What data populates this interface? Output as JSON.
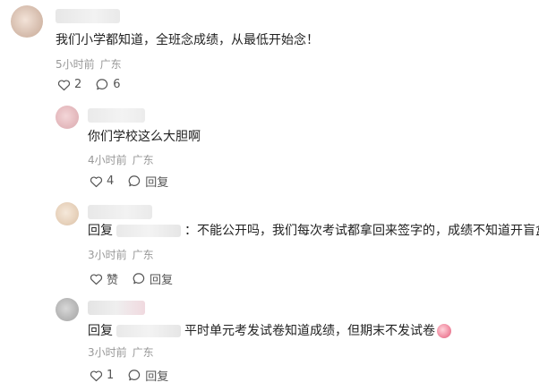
{
  "comments": [
    {
      "text": "我们小学都知道，全班念成绩，从最低开始念！",
      "time": "5小时前",
      "location": "广东",
      "likes": "2",
      "replies": "6"
    }
  ],
  "replies": [
    {
      "text": "你们学校这么大胆啊",
      "time": "4小时前",
      "location": "广东",
      "likes": "4",
      "reply_label": "回复"
    },
    {
      "prefix": "回复",
      "text": "：不能公开吗，我们每次考试都拿回来签字的，成绩不知道开盲盒吗",
      "time": "3小时前",
      "location": "广东",
      "like_label": "赞",
      "reply_label": "回复"
    },
    {
      "prefix": "回复",
      "text": "平时单元考发试卷知道成绩，但期末不发试卷",
      "time": "3小时前",
      "location": "广东",
      "likes": "1",
      "reply_label": "回复"
    }
  ],
  "icons": {
    "like": "heart-outline-icon",
    "comment": "speech-bubble-icon",
    "emoji": "crying-face-emoji"
  }
}
